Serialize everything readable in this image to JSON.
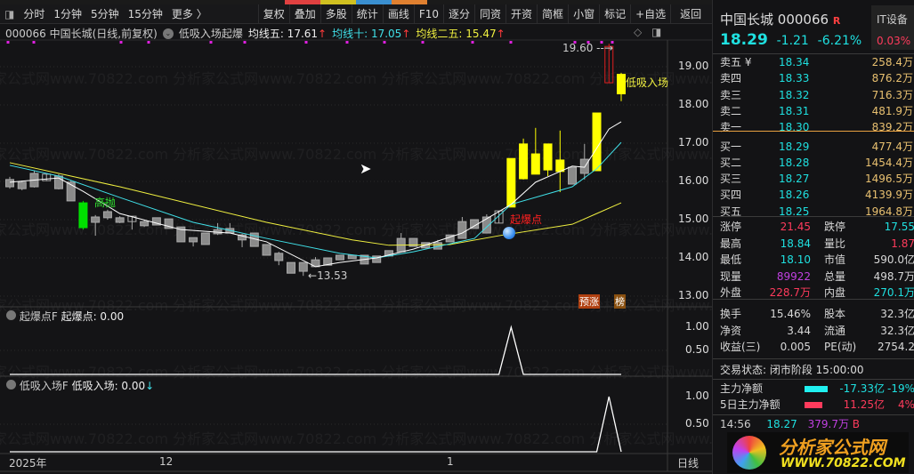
{
  "toolbar": {
    "periods": [
      "分时",
      "1分钟",
      "5分钟",
      "15分钟",
      "更多 〉"
    ],
    "buttons": [
      "复权",
      "叠加",
      "多股",
      "统计",
      "画线",
      "F10",
      "逐分",
      "同资",
      "开资",
      "简框",
      "小窗",
      "标记",
      "+自选",
      "返回"
    ]
  },
  "infoline": {
    "title": "000066 中国长城(日线,前复权)",
    "indicator": "低吸入场起爆",
    "ma5": "均线五: 17.61",
    "ma10": "均线十: 17.05",
    "ma25": "均线二五: 15.47",
    "arrow": "↑"
  },
  "price_axis": [
    "19.00",
    "18.00",
    "17.00",
    "16.00",
    "15.00",
    "14.00",
    "13.00"
  ],
  "chart": {
    "candles": [
      [
        16.05,
        16.12,
        15.81,
        15.86,
        "gray"
      ],
      [
        15.98,
        16.02,
        15.77,
        15.81,
        "gray"
      ],
      [
        15.86,
        16.28,
        15.84,
        16.21,
        "gray"
      ],
      [
        16.02,
        16.19,
        16.02,
        16.19,
        "hollow"
      ],
      [
        16.14,
        16.19,
        15.79,
        15.81,
        "gray"
      ],
      [
        15.98,
        16.02,
        15.49,
        15.49,
        "gray"
      ],
      [
        15.44,
        15.49,
        14.74,
        14.79,
        "green"
      ],
      [
        14.93,
        15.12,
        14.58,
        15.07,
        "gray"
      ],
      [
        15.05,
        15.26,
        15.0,
        15.21,
        "gray"
      ],
      [
        15.05,
        15.09,
        14.91,
        14.93,
        "gray"
      ],
      [
        14.95,
        15.09,
        14.74,
        15.09,
        "hollow"
      ],
      [
        14.95,
        15.0,
        14.81,
        14.84,
        "gray"
      ],
      [
        14.86,
        15.05,
        14.86,
        15.05,
        "gray"
      ],
      [
        15.02,
        15.02,
        14.77,
        14.77,
        "gray"
      ],
      [
        14.81,
        14.81,
        14.42,
        14.42,
        "gray"
      ],
      [
        14.53,
        14.53,
        14.3,
        14.42,
        "gray"
      ],
      [
        14.65,
        14.65,
        14.35,
        14.35,
        "gray"
      ],
      [
        14.63,
        14.91,
        14.6,
        14.74,
        "gray"
      ],
      [
        14.65,
        14.91,
        14.65,
        14.77,
        "gray"
      ],
      [
        14.6,
        14.63,
        14.28,
        14.47,
        "gray"
      ],
      [
        14.65,
        14.65,
        14.3,
        14.3,
        "gray"
      ],
      [
        14.35,
        14.35,
        14.07,
        14.07,
        "gray"
      ],
      [
        14.12,
        14.16,
        13.81,
        13.93,
        "gray"
      ],
      [
        13.88,
        13.88,
        13.6,
        13.6,
        "gray"
      ],
      [
        13.65,
        13.88,
        13.53,
        13.88,
        "gray"
      ],
      [
        13.77,
        14.02,
        13.77,
        13.95,
        "gray"
      ],
      [
        13.81,
        14.0,
        13.81,
        14.0,
        "gray"
      ],
      [
        13.95,
        14.07,
        13.95,
        14.07,
        "gray"
      ],
      [
        13.98,
        14.07,
        13.98,
        14.07,
        "gray"
      ],
      [
        14.07,
        14.07,
        13.84,
        13.84,
        "gray"
      ],
      [
        13.88,
        14.05,
        13.88,
        14.05,
        "gray"
      ],
      [
        14.05,
        14.19,
        14.05,
        14.19,
        "gray"
      ],
      [
        14.16,
        14.65,
        14.16,
        14.51,
        "gray"
      ],
      [
        14.3,
        14.51,
        14.3,
        14.51,
        "gray"
      ],
      [
        14.4,
        14.4,
        14.26,
        14.26,
        "gray"
      ],
      [
        14.23,
        14.47,
        14.23,
        14.4,
        "gray"
      ],
      [
        14.42,
        14.6,
        14.42,
        14.6,
        "gray"
      ],
      [
        14.51,
        15.07,
        14.51,
        14.95,
        "gray"
      ],
      [
        15.0,
        15.0,
        14.77,
        14.77,
        "gray"
      ],
      [
        14.65,
        15.14,
        14.65,
        15.07,
        "gray"
      ],
      [
        14.91,
        15.23,
        14.91,
        15.23,
        "hollow"
      ],
      [
        15.33,
        16.6,
        15.33,
        16.6,
        "yellow"
      ],
      [
        16.98,
        17.12,
        16.05,
        16.07,
        "yellow"
      ],
      [
        16.19,
        17.4,
        16.19,
        16.72,
        "yellow"
      ],
      [
        16.98,
        16.98,
        16.14,
        16.3,
        "yellow"
      ],
      [
        16.56,
        17.33,
        15.72,
        16.26,
        "yellow"
      ],
      [
        16.37,
        16.37,
        15.93,
        15.93,
        "gray"
      ],
      [
        16.21,
        16.98,
        16.05,
        16.58,
        "gray"
      ],
      [
        16.28,
        17.79,
        16.28,
        17.79,
        "yellow"
      ],
      [
        19.53,
        19.6,
        18.58,
        18.58,
        "red"
      ],
      [
        18.8,
        18.84,
        18.1,
        18.29,
        "yellow"
      ]
    ],
    "ma5": [
      [
        0,
        15.98
      ],
      [
        4,
        16.09
      ],
      [
        6,
        15.74
      ],
      [
        9,
        15.16
      ],
      [
        14,
        14.74
      ],
      [
        18,
        14.65
      ],
      [
        21,
        14.42
      ],
      [
        25,
        13.77
      ],
      [
        27,
        13.88
      ],
      [
        30,
        14.0
      ],
      [
        33,
        14.23
      ],
      [
        37,
        14.65
      ],
      [
        41,
        15.4
      ],
      [
        43,
        15.98
      ],
      [
        46,
        16.4
      ],
      [
        47,
        16.37
      ],
      [
        49,
        17.37
      ],
      [
        50,
        17.56
      ]
    ],
    "ma10": [
      [
        0,
        16.42
      ],
      [
        4,
        16.14
      ],
      [
        9,
        15.58
      ],
      [
        15,
        14.93
      ],
      [
        21,
        14.51
      ],
      [
        27,
        14.12
      ],
      [
        30,
        14.0
      ],
      [
        33,
        14.16
      ],
      [
        38,
        14.51
      ],
      [
        41,
        15.4
      ],
      [
        46,
        15.86
      ],
      [
        48,
        16.33
      ],
      [
        50,
        17.02
      ]
    ],
    "ma25": [
      [
        0,
        16.49
      ],
      [
        9,
        15.86
      ],
      [
        21,
        14.93
      ],
      [
        28,
        14.47
      ],
      [
        31,
        14.33
      ],
      [
        36,
        14.35
      ],
      [
        40,
        14.58
      ],
      [
        46,
        14.88
      ],
      [
        48,
        15.16
      ],
      [
        50,
        15.44
      ]
    ],
    "colors": {
      "ma5": "#ffffff",
      "ma10": "#40e0e8",
      "ma25": "#f0f040",
      "yellow": "#ffff00",
      "gray": "#8a8a8a",
      "green": "#00e000",
      "red": "#e02020"
    },
    "labels": {
      "high_sell": "高抛",
      "breakout": "起爆点",
      "low": "13.53",
      "high": "19.60",
      "low_buy": "低吸入场",
      "badge1": "预涨",
      "badge2": "榜"
    }
  },
  "panel1": {
    "name": "起爆点F",
    "value": "起爆点: 0.00",
    "ticks": [
      "1.00",
      "0.50"
    ],
    "signals": [
      41
    ]
  },
  "panel2": {
    "name": "低吸入场F",
    "value": "低吸入场: 0.00",
    "arrow": "↓",
    "ticks": [
      "1.00",
      "0.50"
    ],
    "signals": [
      49
    ]
  },
  "date_axis": {
    "labels": [
      "2025年",
      "12",
      "1"
    ],
    "period": "日线"
  },
  "quote": {
    "name": "中国长城",
    "code": "000066",
    "badge": "R",
    "sector": "IT设备",
    "sector_change": "0.03%",
    "price": "18.29",
    "change": "-1.21",
    "pct": "-6.21%",
    "asks": [
      [
        "卖五 ¥",
        "18.34",
        "258.4万"
      ],
      [
        "卖四",
        "18.33",
        "876.2万"
      ],
      [
        "卖三",
        "18.32",
        "716.3万"
      ],
      [
        "卖二",
        "18.31",
        "481.9万"
      ],
      [
        "卖一",
        "18.30",
        "839.2万"
      ]
    ],
    "bids": [
      [
        "买一",
        "18.29",
        "477.4万"
      ],
      [
        "买二",
        "18.28",
        "1454.4万"
      ],
      [
        "买三",
        "18.27",
        "1496.5万"
      ],
      [
        "买四",
        "18.26",
        "4139.9万"
      ],
      [
        "买五",
        "18.25",
        "1964.8万"
      ]
    ],
    "stats": [
      [
        "涨停",
        "21.45",
        "rd",
        "跌停",
        "17.55",
        "cy"
      ],
      [
        "最高",
        "18.84",
        "cy",
        "量比",
        "1.87",
        "rd"
      ],
      [
        "最低",
        "18.10",
        "cy",
        "市值",
        "590.0亿",
        "wh"
      ],
      [
        "现量",
        "89922",
        "mg",
        "总量",
        "498.7万",
        "wh"
      ],
      [
        "外盘",
        "228.7万",
        "rd",
        "内盘",
        "270.1万",
        "cy"
      ]
    ],
    "stats2": [
      [
        "换手",
        "15.46%",
        "股本",
        "32.3亿"
      ],
      [
        "净资",
        "3.44",
        "流通",
        "32.3亿"
      ],
      [
        "收益(三)",
        "0.005",
        "PE(动)",
        "2754.2"
      ]
    ],
    "status": "交易状态: 闭市阶段 15:00:00",
    "flow": [
      [
        "主力净额",
        "-17.33亿",
        "-19%",
        "cy"
      ],
      [
        "5日主力净额",
        "11.25亿",
        "4%",
        "rd"
      ]
    ],
    "tick": [
      "14:56",
      "18.27",
      "379.7万",
      "B"
    ],
    "logo_text": "分析家公式网",
    "logo_url": "WWW.70822.COM",
    "watermark": "分析家公式网www.70822.com"
  }
}
